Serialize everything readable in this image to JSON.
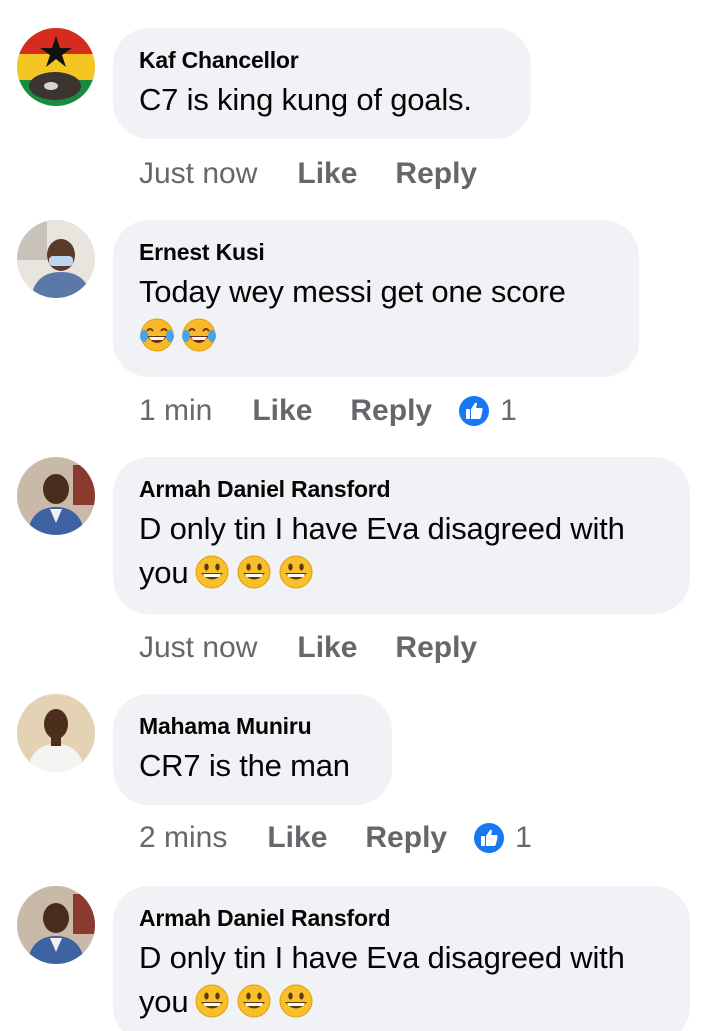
{
  "comments": [
    {
      "author": "Kaf Chancellor",
      "text": "C7 is king kung of goals.",
      "time": "Just now",
      "like_label": "Like",
      "reply_label": "Reply"
    },
    {
      "author": "Ernest Kusi",
      "text": "Today wey messi get one score",
      "emojis": [
        "face-with-tears-of-joy-emoji",
        "face-with-tears-of-joy-emoji"
      ],
      "time": "1 min",
      "like_label": "Like",
      "reply_label": "Reply",
      "reaction_count": "1"
    },
    {
      "author": "Armah Daniel Ransford",
      "text": "D only tin I have Eva disagreed with",
      "text2": "you",
      "emojis": [
        "grinning-face-emoji",
        "grinning-face-emoji",
        "grinning-face-emoji"
      ],
      "time": "Just now",
      "like_label": "Like",
      "reply_label": "Reply"
    },
    {
      "author": "Mahama Muniru",
      "text": "CR7 is the man",
      "time": "2 mins",
      "like_label": "Like",
      "reply_label": "Reply",
      "reaction_count": "1"
    },
    {
      "author": "Armah Daniel Ransford",
      "text": "D only tin I have Eva disagreed with",
      "text2": "you",
      "emojis": [
        "grinning-face-emoji",
        "grinning-face-emoji",
        "grinning-face-emoji"
      ]
    }
  ],
  "colors": {
    "bubble": "#f0f2f5",
    "meta_text": "#65676b",
    "like_blue": "#1877f2"
  }
}
